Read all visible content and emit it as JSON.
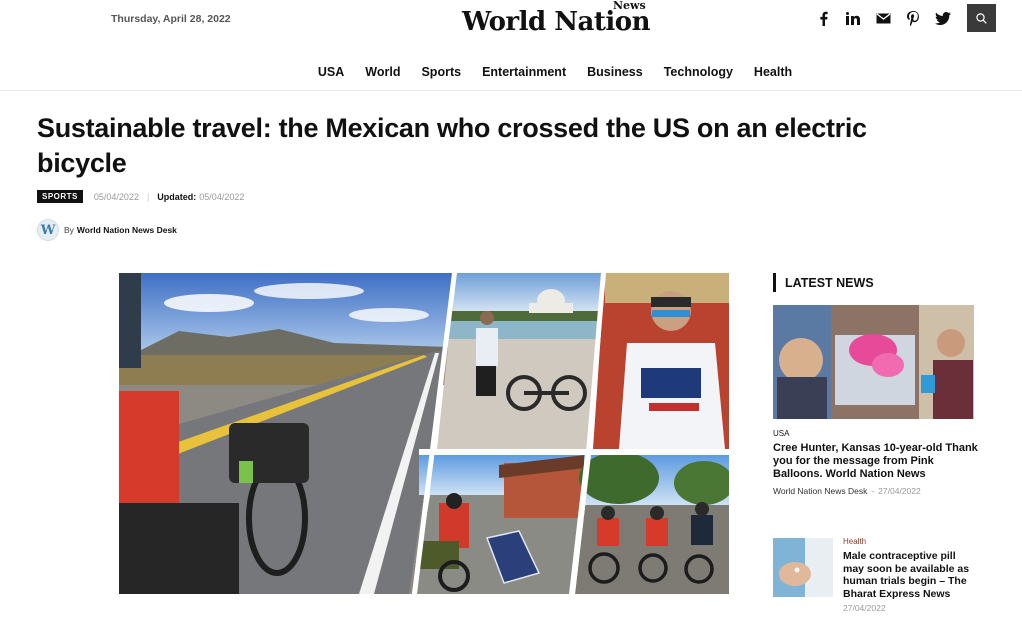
{
  "header": {
    "date": "Thursday, April 28, 2022",
    "logo_main": "World Nation",
    "logo_sub": "News",
    "social": [
      {
        "name": "facebook-icon",
        "glyph": "f"
      },
      {
        "name": "linkedin-icon",
        "glyph": "in"
      },
      {
        "name": "mail-icon",
        "glyph": "✉"
      },
      {
        "name": "pinterest-icon",
        "glyph": "℗"
      },
      {
        "name": "twitter-icon",
        "glyph": "🐦"
      }
    ],
    "search_icon": "search-icon"
  },
  "nav": {
    "items": [
      "USA",
      "World",
      "Sports",
      "Entertainment",
      "Business",
      "Technology",
      "Health"
    ]
  },
  "article": {
    "title": "Sustainable travel: the Mexican who crossed the US on an electric bicycle",
    "category": "SPORTS",
    "published": "05/04/2022",
    "updated_label": "Updated:",
    "updated": "05/04/2022",
    "by": "By",
    "author": "World Nation News Desk",
    "avatar_letter": "W"
  },
  "sidebar": {
    "heading": "LATEST NEWS",
    "items": [
      {
        "category": "USA",
        "title": "Cree Hunter, Kansas 10-year-old Thank you for the message from Pink Balloons. World Nation News",
        "author": "World Nation News Desk",
        "sep": "-",
        "date": "27/04/2022"
      },
      {
        "category": "Health",
        "title": "Male contraceptive pill may soon be available as human trials begin – The Bharat Express News",
        "date": "27/04/2022"
      }
    ]
  },
  "colors": {
    "accent": "#111111",
    "search_bg": "#3a3a3a",
    "health_tag": "#8a3b2e"
  }
}
